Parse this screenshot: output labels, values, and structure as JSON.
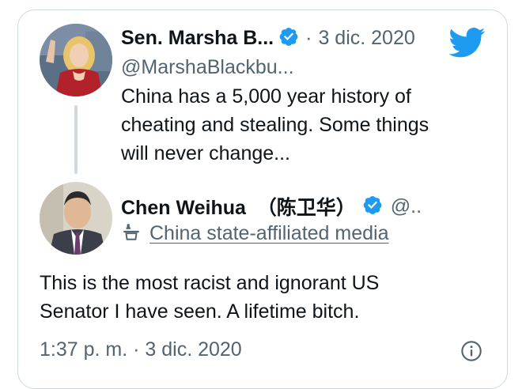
{
  "quoted_tweet": {
    "author_name": "Sen. Marsha B...",
    "handle": "@MarshaBlackbu...",
    "date": "3 dic. 2020",
    "separator": "·",
    "text_lines": [
      "China has a 5,000 year history of",
      "cheating and stealing. Some things",
      "will never change..."
    ]
  },
  "reply": {
    "author_name": "Chen Weihua  （陈卫华）",
    "handle": "@..",
    "affiliation_label": "China state-affiliated media",
    "text_lines": [
      "This is the most racist and ignorant US",
      "Senator I have seen.  A lifetime bitch."
    ],
    "timestamp": "1:37 p. m. · 3 dic. 2020"
  },
  "icons": {
    "verified": "verified-badge-icon",
    "twitter": "twitter-bird-icon",
    "state_media": "state-media-podium-icon",
    "info": "info-icon"
  },
  "colors": {
    "accent": "#1d9bf0",
    "muted": "#536471",
    "border": "#cfd9de"
  }
}
